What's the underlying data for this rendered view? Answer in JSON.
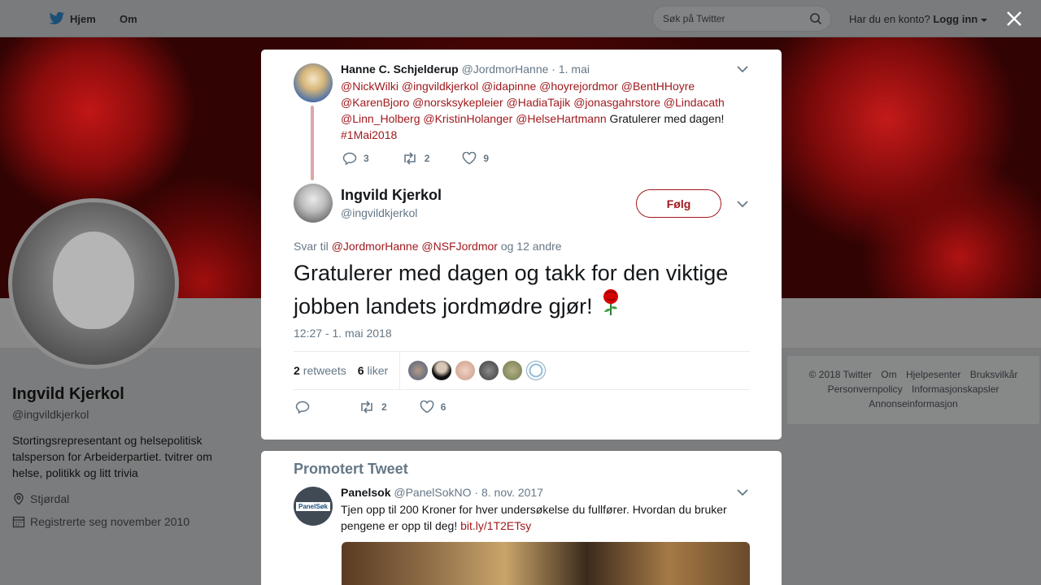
{
  "topbar": {
    "home_label": "Hjem",
    "om_label": "Om",
    "search_placeholder": "Søk på Twitter",
    "login_question": "Har du en konto?",
    "login_label": "Logg inn"
  },
  "profile": {
    "name": "Ingvild Kjerkol",
    "handle": "@ingvildkjerkol",
    "bio": "Stortingsrepresentant og helsepolitisk talsperson for Arbeiderpartiet. tvitrer om helse, politikk og litt trivia",
    "location": "Stjørdal",
    "joined": "Registrerte seg november 2010"
  },
  "footer": {
    "links": [
      "© 2018 Twitter",
      "Om",
      "Hjelpesenter",
      "Bruksvilkår",
      "Personvernpolicy",
      "Informasjonskapsler",
      "Annonseinformasjon"
    ]
  },
  "context_tweet": {
    "name": "Hanne C. Schjelderup",
    "handle": "@JordmorHanne",
    "date": "· 1. mai",
    "mentions": "@NickWilki @ingvildkjerkol @idapinne @hoyrejordmor @BentHHoyre @KarenBjoro @norsksykepleier @HadiaTajik @jonasgahrstore @Lindacath @Linn_Holberg @KristinHolanger @HelseHartmann",
    "text": " Gratulerer med dagen!",
    "hashtag": "#1Mai2018",
    "replies": "3",
    "retweets": "2",
    "likes": "9"
  },
  "main_tweet": {
    "name": "Ingvild Kjerkol",
    "handle": "@ingvildkjerkol",
    "follow_label": "Følg",
    "reply_prefix": "Svar til",
    "reply_mentions": "@JordmorHanne @NSFJordmor",
    "reply_suffix": "og 12 andre",
    "text": "Gratulerer med dagen og takk for den viktige jobben landets jordmødre gjør!",
    "timestamp": "12:27 - 1. mai 2018",
    "retweets_count": "2",
    "retweets_label": "retweets",
    "likes_count": "6",
    "likes_label": "liker",
    "action_retweets": "2",
    "action_likes": "6"
  },
  "promoted": {
    "title": "Promotert Tweet",
    "name": "Panelsok",
    "handle": "@PanelSokNO",
    "date": "· 8. nov. 2017",
    "avatar_text": "PanelSøk",
    "text": "Tjen opp til 200 Kroner for hver undersøkelse du fullfører. Hvordan du bruker pengene er opp til deg!",
    "link": "bit.ly/1T2ETsy"
  },
  "colors": {
    "accent": "#a0191d",
    "muted": "#657786"
  }
}
